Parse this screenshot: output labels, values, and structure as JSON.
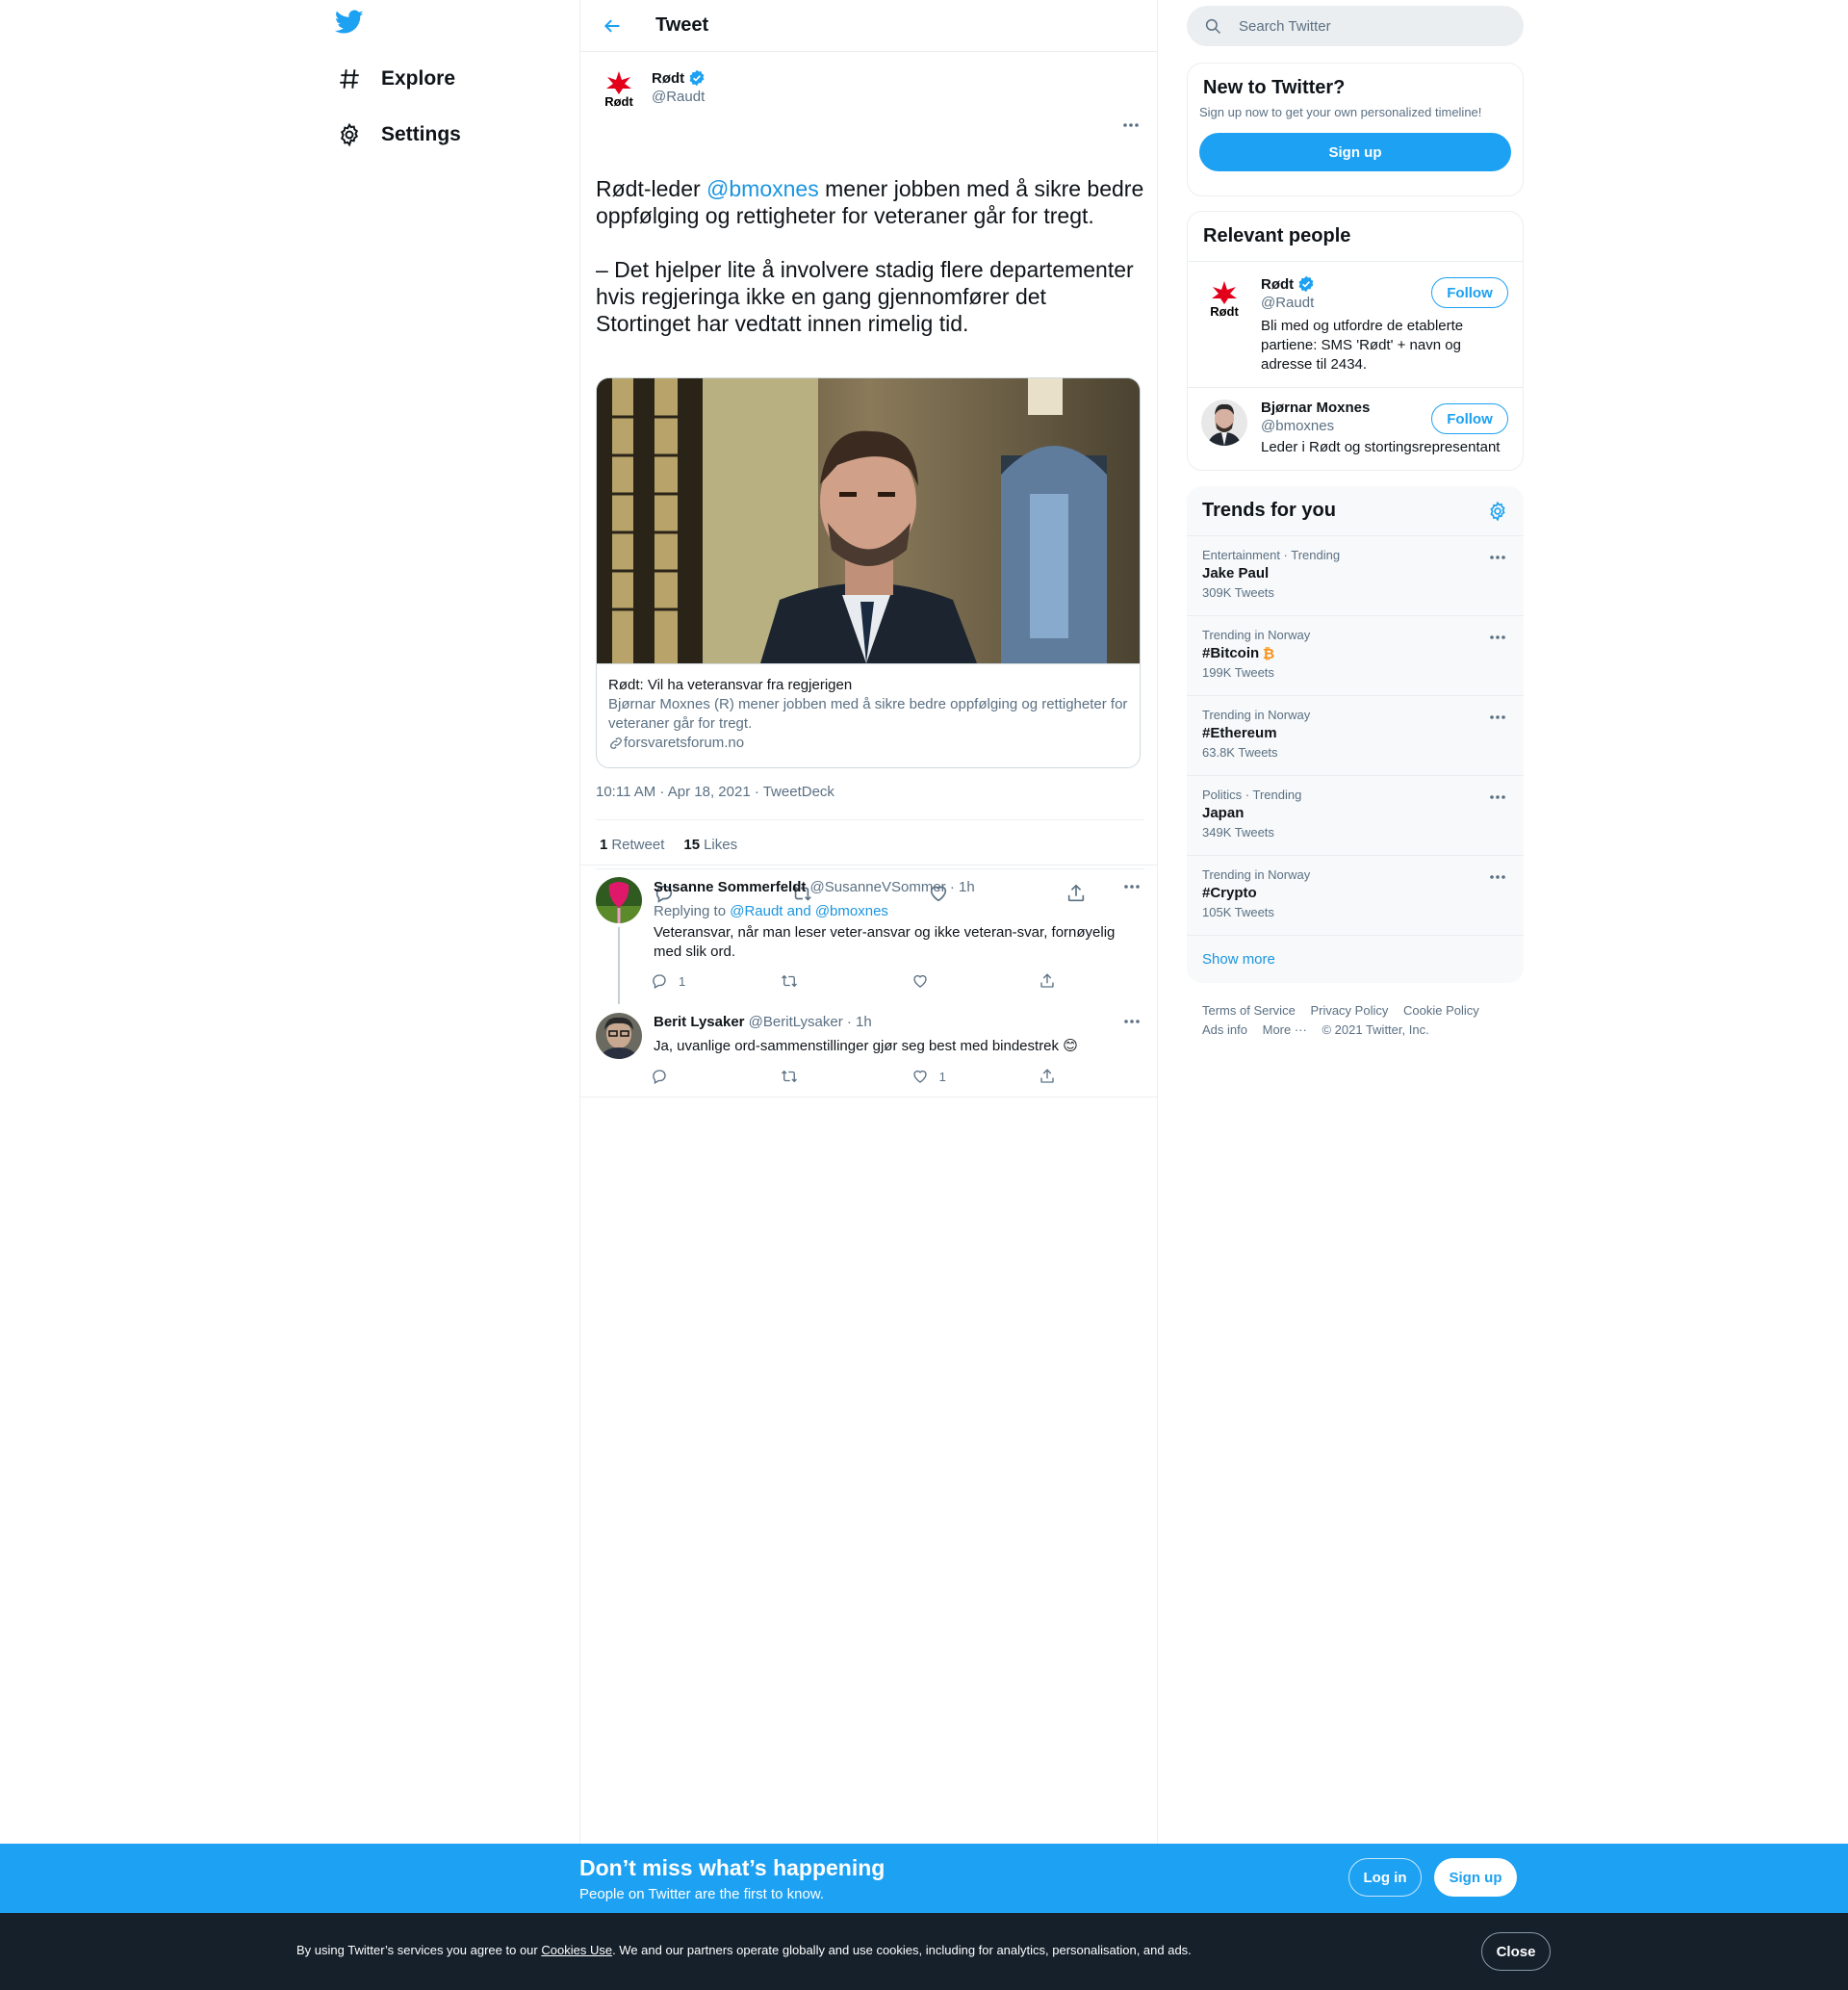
{
  "nav": {
    "logo": "twitter-bird-icon",
    "items": [
      {
        "label": "Explore",
        "icon": "hashtag-icon"
      },
      {
        "label": "Settings",
        "icon": "gear-icon"
      }
    ]
  },
  "header": {
    "title": "Tweet",
    "back_icon": "arrow-left-icon"
  },
  "tweet": {
    "author": {
      "name": "Rødt",
      "handle": "@Raudt",
      "avatar_text": "Rødt"
    },
    "text_before": "Rødt-leder ",
    "mention": "@bmoxnes",
    "text_after": " mener jobben med å sikre bedre oppfølging og rettigheter for veteraner går for tregt.\n\n– Det hjelper lite å involvere stadig flere departementer hvis regjeringa ikke en gang gjennomfører det Stortinget har vedtatt innen rimelig tid.",
    "card": {
      "title": "Rødt: Vil ha veteransvar fra regjerigen",
      "description": "Bjørnar Moxnes (R) mener jobben med å sikre bedre oppfølging og rettigheter for veteraner går for tregt.",
      "domain": "forsvaretsforum.no"
    },
    "time": "10:11 AM · Apr 18, 2021 · TweetDeck",
    "stats": {
      "retweets": "1",
      "retweets_label": "Retweet",
      "likes": "15",
      "likes_label": "Likes"
    }
  },
  "replies": [
    {
      "name": "Susanne Sommerfeldt",
      "handle": "@SusanneVSommer",
      "time": "· 1h",
      "replying_label": "Replying to ",
      "replying_to": "@Raudt and @bmoxnes",
      "text": "Veteransvar, når man leser veter-ansvar og ikke veteran-svar, fornøyelig med slik ord.",
      "reply_count": "1",
      "retweet_count": "",
      "like_count": ""
    },
    {
      "name": "Berit Lysaker",
      "handle": "@BeritLysaker",
      "time": "· 1h",
      "text": "Ja, uvanlige ord-sammenstillinger gjør seg best med bindestrek 😊",
      "reply_count": "",
      "retweet_count": "",
      "like_count": "1"
    }
  ],
  "search": {
    "placeholder": "Search Twitter"
  },
  "new_to_twitter": {
    "title": "New to Twitter?",
    "subtitle": "Sign up now to get your own personalized timeline!",
    "button": "Sign up"
  },
  "relevant_people": {
    "title": "Relevant people",
    "people": [
      {
        "name": "Rødt",
        "handle": "@Raudt",
        "bio": "Bli med og utfordre de etablerte partiene: SMS 'Rødt' + navn og adresse til 2434.",
        "follow": "Follow",
        "avatar_text": "Rødt"
      },
      {
        "name": "Bjørnar Moxnes",
        "handle": "@bmoxnes",
        "bio": "Leder i Rødt og stortingsrepresentant",
        "follow": "Follow"
      }
    ]
  },
  "trends": {
    "title": "Trends for you",
    "items": [
      {
        "context": "Entertainment · Trending",
        "name": "Jake Paul",
        "count": "309K Tweets"
      },
      {
        "context": "Trending in Norway",
        "name": "#Bitcoin",
        "count": "199K Tweets"
      },
      {
        "context": "Trending in Norway",
        "name": "#Ethereum",
        "count": "63.8K Tweets"
      },
      {
        "context": "Politics · Trending",
        "name": "Japan",
        "count": "349K Tweets"
      },
      {
        "context": "Trending in Norway",
        "name": "#Crypto",
        "count": "105K Tweets"
      }
    ],
    "show_more": "Show more"
  },
  "footer": {
    "links": [
      "Terms of Service",
      "Privacy Policy",
      "Cookie Policy",
      "Ads info",
      "More ···",
      "© 2021 Twitter, Inc."
    ]
  },
  "banner": {
    "title": "Don’t miss what’s happening",
    "subtitle": "People on Twitter are the first to know.",
    "login": "Log in",
    "signup": "Sign up"
  },
  "cookie": {
    "before": "By using Twitter’s services you agree to our ",
    "link": "Cookies Use",
    "after": ". We and our partners operate globally and use cookies, including for analytics, personalisation, and ads.",
    "close": "Close"
  },
  "colors": {
    "accent": "#1da1f2",
    "link": "#1b95e0",
    "muted": "#5b7083",
    "rodt_red": "#e3001b"
  }
}
